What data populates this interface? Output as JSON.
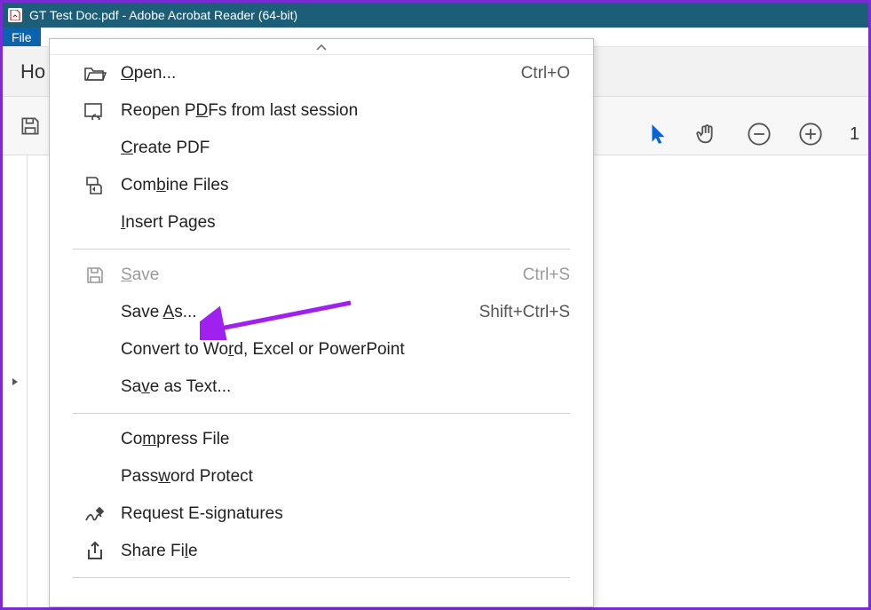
{
  "window": {
    "title": "GT Test Doc.pdf - Adobe Acrobat Reader (64-bit)"
  },
  "menubar": {
    "file": "File"
  },
  "tabs": {
    "home_partial": "Ho"
  },
  "toolbar_right": {
    "zoom_partial": "1"
  },
  "dropdown": {
    "open": {
      "label_pre": "",
      "label_u": "O",
      "label_post": "pen...",
      "shortcut": "Ctrl+O"
    },
    "reopen": {
      "label_pre": "Reopen P",
      "label_u": "D",
      "label_post": "Fs from last session",
      "shortcut": ""
    },
    "createpdf": {
      "label_pre": "",
      "label_u": "C",
      "label_post": "reate PDF",
      "shortcut": ""
    },
    "combine": {
      "label_pre": "Com",
      "label_u": "b",
      "label_post": "ine Files",
      "shortcut": ""
    },
    "insert": {
      "label_pre": "",
      "label_u": "I",
      "label_post": "nsert Pages",
      "shortcut": ""
    },
    "save": {
      "label_pre": "",
      "label_u": "S",
      "label_post": "ave",
      "shortcut": "Ctrl+S"
    },
    "saveas": {
      "label_pre": "Save ",
      "label_u": "A",
      "label_post": "s...",
      "shortcut": "Shift+Ctrl+S"
    },
    "convert": {
      "label_pre": "Convert to Wo",
      "label_u": "r",
      "label_post": "d, Excel or PowerPoint",
      "shortcut": ""
    },
    "savetext": {
      "label_pre": "Sa",
      "label_u": "v",
      "label_post": "e as Text...",
      "shortcut": ""
    },
    "compress": {
      "label_pre": "Co",
      "label_u": "m",
      "label_post": "press File",
      "shortcut": ""
    },
    "password": {
      "label_pre": "Pass",
      "label_u": "w",
      "label_post": "ord Protect",
      "shortcut": ""
    },
    "esign": {
      "label_pre": "Request E-si",
      "label_u": "g",
      "label_post": "natures",
      "shortcut": ""
    },
    "share": {
      "label_pre": "Share Fi",
      "label_u": "l",
      "label_post": "e",
      "shortcut": ""
    }
  }
}
